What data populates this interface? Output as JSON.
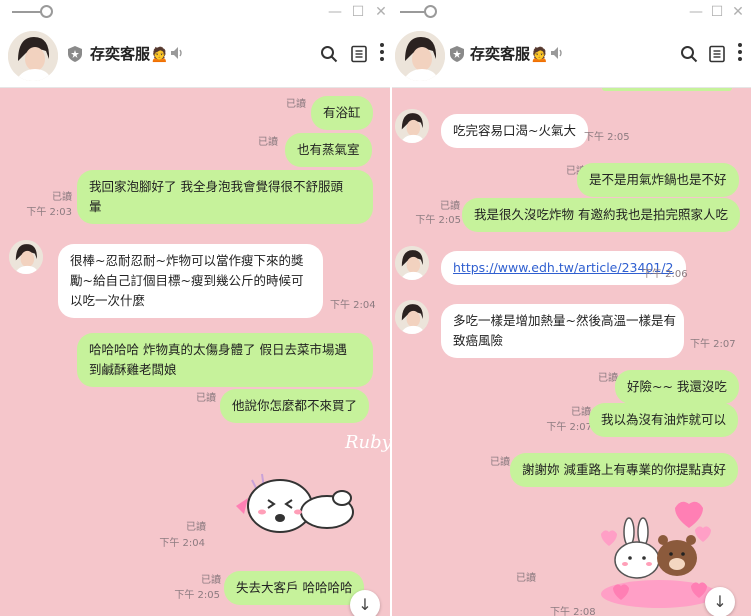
{
  "colors": {
    "chat_bg": "#f5c6cb",
    "outgoing_bubble": "#c6f29b",
    "incoming_bubble": "#ffffff",
    "link": "#2f5fd0"
  },
  "left": {
    "header": {
      "title": "存奕客服🙍",
      "icons": [
        "shield-icon",
        "mute-icon",
        "search-icon",
        "notes-icon",
        "more-icon"
      ]
    },
    "window_controls": [
      "minimize",
      "maximize",
      "close"
    ],
    "messages": [
      {
        "dir": "out",
        "text": "有浴缸",
        "read": "已讀",
        "time": ""
      },
      {
        "dir": "out",
        "text": "也有蒸氣室",
        "read": "已讀",
        "time": ""
      },
      {
        "dir": "out",
        "lines": [
          "我回家泡腳好了 我全身泡我會覺得很不舒服頭",
          "暈"
        ],
        "read": "已讀",
        "time": "下午 2:03"
      },
      {
        "dir": "in",
        "lines": [
          "很棒~忍耐忍耐~炸物可以當作瘦下來的獎",
          "勵~給自己訂個目標~瘦到幾公斤的時候可",
          "以吃一次什麼"
        ],
        "time": "下午 2:04"
      },
      {
        "dir": "out",
        "lines": [
          "哈哈哈哈 炸物真的太傷身體了 假日去菜市場遇",
          "到鹹酥雞老闆娘"
        ],
        "read": "",
        "time": ""
      },
      {
        "dir": "out",
        "text": "他說你怎麼都不來買了",
        "read": "已讀",
        "time": ""
      },
      {
        "dir": "sticker",
        "name": "line-brown-cony-sticker",
        "read": "已讀",
        "time": "下午 2:04"
      },
      {
        "dir": "out",
        "text": "失去大客戶  哈哈哈哈",
        "read": "已讀",
        "time": "下午 2:05"
      }
    ],
    "watermark": "Ruby"
  },
  "right": {
    "header": {
      "title": "存奕客服🙍",
      "icons": [
        "shield-icon",
        "mute-icon",
        "search-icon",
        "notes-icon",
        "more-icon"
      ]
    },
    "window_controls": [
      "minimize",
      "maximize",
      "close"
    ],
    "messages": [
      {
        "dir": "in",
        "text": "吃完容易口渴~火氣大",
        "time": "下午 2:05"
      },
      {
        "dir": "out",
        "text": "是不是用氣炸鍋也是不好",
        "read": "已讀",
        "time": ""
      },
      {
        "dir": "out",
        "text": "我是很久沒吃炸物  有邀約我也是拍完照家人吃",
        "read": "已讀",
        "time": "下午 2:05"
      },
      {
        "dir": "in",
        "text": "https://www.edh.tw/article/23401/2",
        "time": "下午 2:06"
      },
      {
        "dir": "in",
        "lines": [
          "多吃一樣是增加熱量~然後高溫一樣是有",
          "致癌風險"
        ],
        "time": "下午 2:07"
      },
      {
        "dir": "out",
        "text": "好險~~  我還沒吃",
        "read": "已讀",
        "time": ""
      },
      {
        "dir": "out",
        "text": "我以為沒有油炸就可以",
        "read": "已讀",
        "time": "下午 2:07"
      },
      {
        "dir": "out",
        "text": "謝謝妳  減重路上有專業的你提點真好",
        "read": "已讀",
        "time": ""
      },
      {
        "dir": "sticker",
        "name": "brown-cony-hearts-sticker",
        "read": "已讀",
        "time": "下午 2:08"
      }
    ]
  }
}
